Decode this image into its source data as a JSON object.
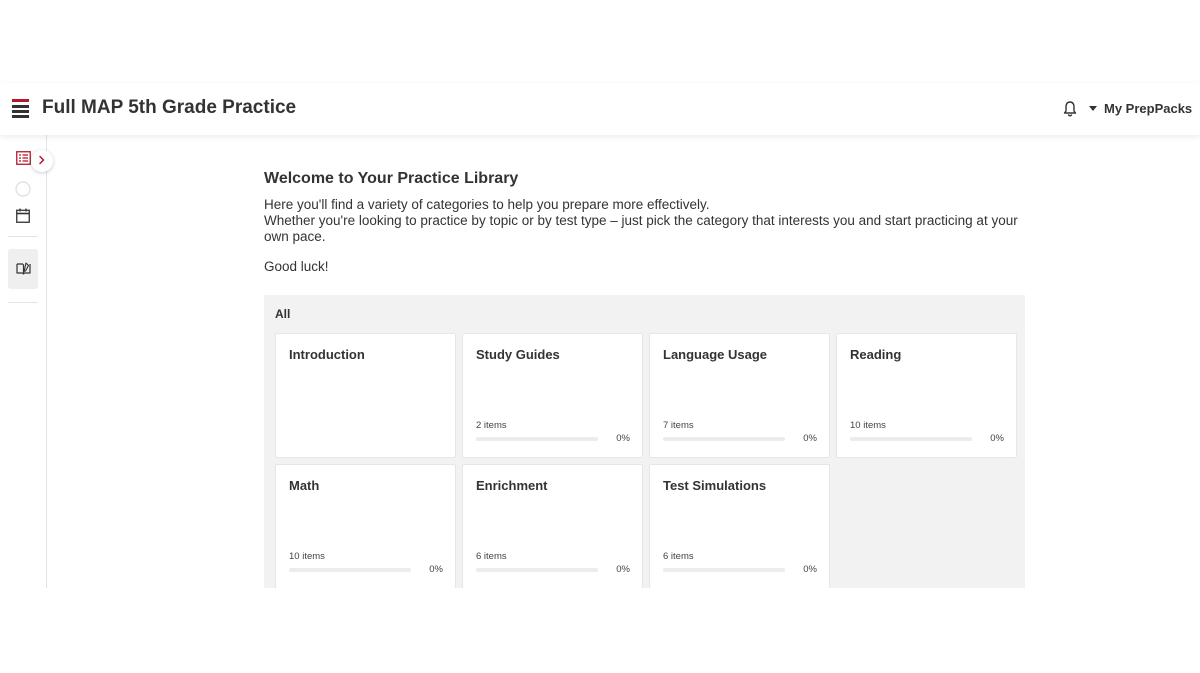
{
  "header": {
    "title": "Full MAP 5th Grade Practice",
    "account_label": "My PrepPacks",
    "icons": [
      "menu-icon",
      "bell-icon",
      "caret-down-icon"
    ],
    "accent_color": "#b5192f"
  },
  "sidebar": {
    "icons": [
      "list-icon",
      "circle-icon",
      "calendar-icon",
      "book-icon",
      "chevron-right-icon"
    ]
  },
  "main": {
    "welcome_title": "Welcome to Your Practice Library",
    "intro_line1": "Here you'll find a variety of categories to help you prepare more effectively.",
    "intro_line2": "Whether you're looking to practice by topic or by test type – just pick the category that interests you and start practicing at your own pace.",
    "good_luck": "Good luck!"
  },
  "library": {
    "section_label": "All",
    "cards": [
      {
        "title": "Introduction",
        "count": "",
        "percent": "",
        "progress": 0
      },
      {
        "title": "Study Guides",
        "count": "2 items",
        "percent": "0%",
        "progress": 0
      },
      {
        "title": "Language Usage",
        "count": "7 items",
        "percent": "0%",
        "progress": 0
      },
      {
        "title": "Reading",
        "count": "10 items",
        "percent": "0%",
        "progress": 0
      },
      {
        "title": "Math",
        "count": "10 items",
        "percent": "0%",
        "progress": 0
      },
      {
        "title": "Enrichment",
        "count": "6 items",
        "percent": "0%",
        "progress": 0
      },
      {
        "title": "Test Simulations",
        "count": "6 items",
        "percent": "0%",
        "progress": 0
      }
    ]
  }
}
